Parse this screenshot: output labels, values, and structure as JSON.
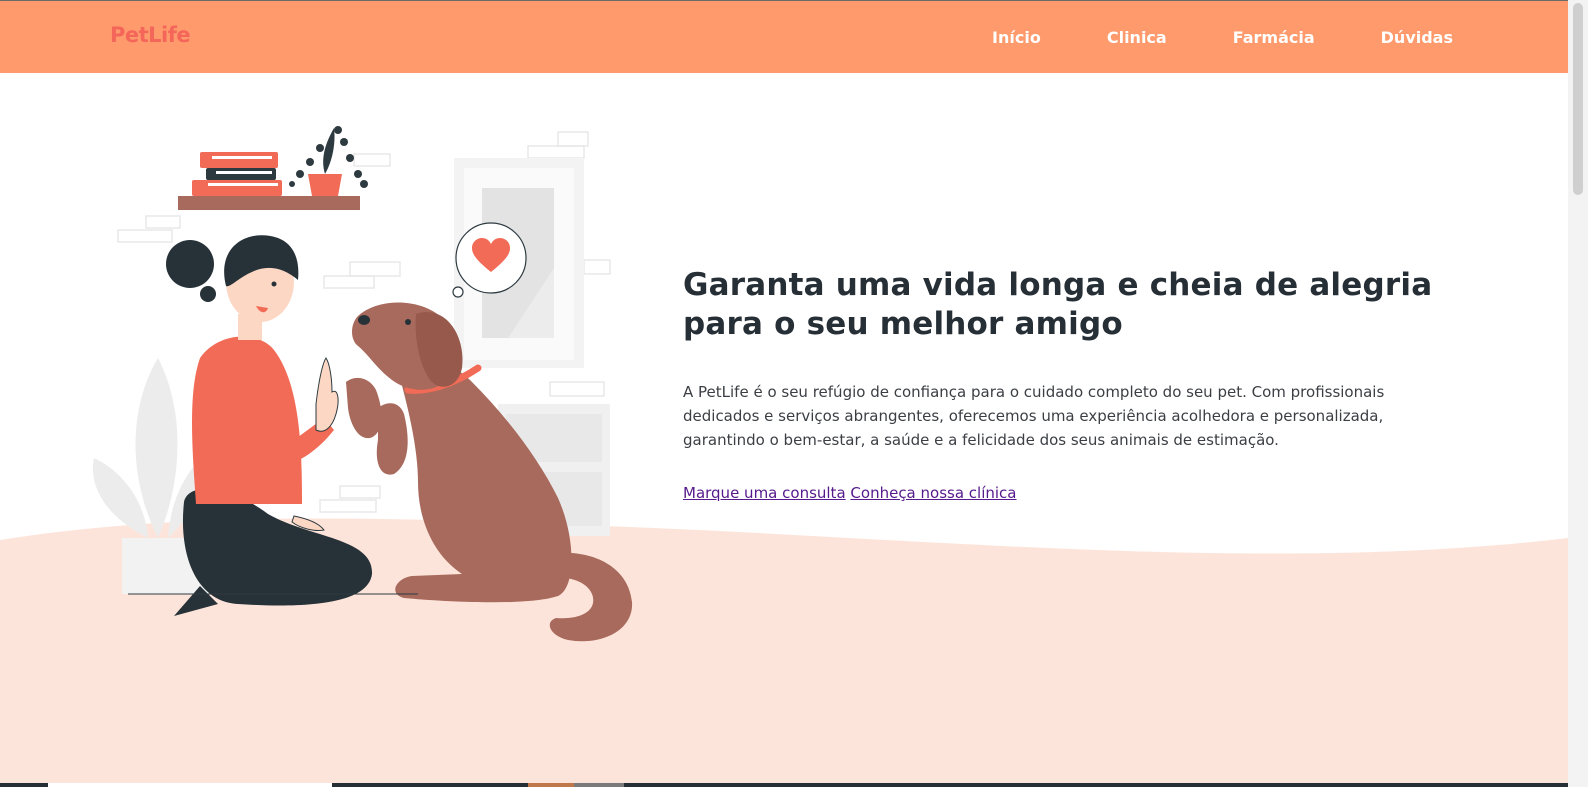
{
  "header": {
    "brand": "PetLife",
    "nav": [
      "Início",
      "Clinica",
      "Farmácia",
      "Dúvidas"
    ]
  },
  "hero": {
    "title": "Garanta uma vida longa e cheia de alegria para o seu melhor amigo",
    "description": "A PetLife é o seu refúgio de confiança para o cuidado completo do seu pet. Com profissionais dedicados e serviços abrangentes, oferecemos uma experiência acolhedora e personalizada, garantindo o bem-estar, a saúde e a felicidade dos seus animais de estimação.",
    "link_appointment": "Marque uma consulta",
    "link_clinic": "Conheça nossa clínica"
  },
  "colors": {
    "header_bg": "#FF9A6C",
    "brand": "#F4665A",
    "hero_wave": "#FDE4DA",
    "title": "#262E36",
    "link": "#551A8B"
  },
  "illustration": {
    "icons": [
      "heart-icon",
      "woman-figure",
      "dog-figure",
      "bookshelf",
      "plant"
    ]
  }
}
